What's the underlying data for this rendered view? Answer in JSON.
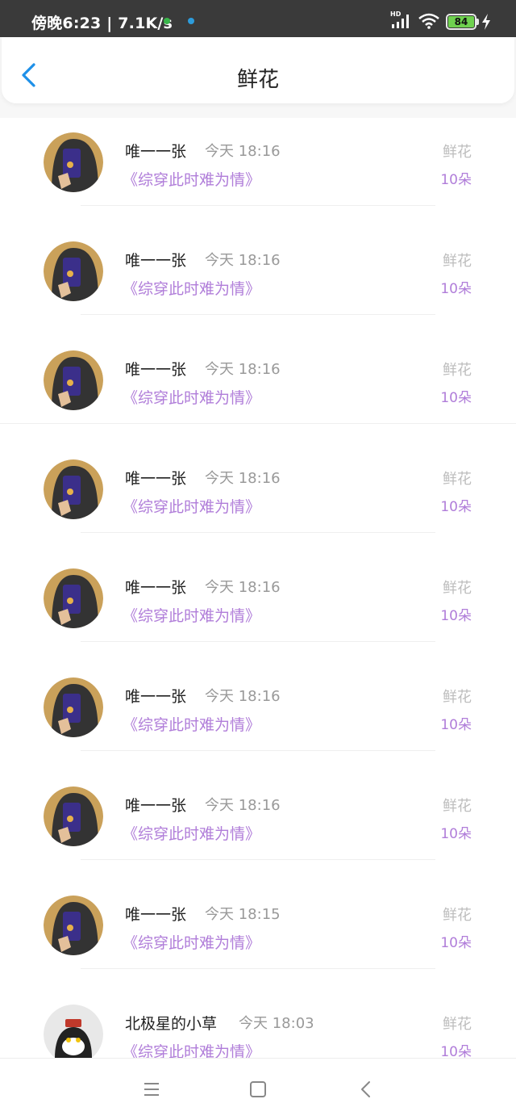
{
  "status_bar": {
    "time_speed": "傍晚6:23 | 7.1K/s",
    "hd_label": "HD",
    "battery": "84",
    "icons": [
      "notification-dot-green",
      "notification-dot-blue",
      "signal-icon",
      "wifi-icon",
      "battery-icon",
      "charging-icon"
    ]
  },
  "header": {
    "back_icon": "chevron-left-icon",
    "title": "鲜花"
  },
  "records": [
    {
      "user": "唯一一张",
      "time": "今天 18:16",
      "book": "《综穿此时难为情》",
      "kind": "鲜花",
      "count": "10朵",
      "avatar": "photo-avatar"
    },
    {
      "user": "唯一一张",
      "time": "今天 18:16",
      "book": "《综穿此时难为情》",
      "kind": "鲜花",
      "count": "10朵",
      "avatar": "photo-avatar"
    },
    {
      "user": "唯一一张",
      "time": "今天 18:16",
      "book": "《综穿此时难为情》",
      "kind": "鲜花",
      "count": "10朵",
      "avatar": "photo-avatar"
    },
    {
      "user": "唯一一张",
      "time": "今天 18:16",
      "book": "《综穿此时难为情》",
      "kind": "鲜花",
      "count": "10朵",
      "avatar": "photo-avatar"
    },
    {
      "user": "唯一一张",
      "time": "今天 18:16",
      "book": "《综穿此时难为情》",
      "kind": "鲜花",
      "count": "10朵",
      "avatar": "photo-avatar"
    },
    {
      "user": "唯一一张",
      "time": "今天 18:16",
      "book": "《综穿此时难为情》",
      "kind": "鲜花",
      "count": "10朵",
      "avatar": "photo-avatar"
    },
    {
      "user": "唯一一张",
      "time": "今天 18:16",
      "book": "《综穿此时难为情》",
      "kind": "鲜花",
      "count": "10朵",
      "avatar": "photo-avatar"
    },
    {
      "user": "唯一一张",
      "time": "今天 18:15",
      "book": "《综穿此时难为情》",
      "kind": "鲜花",
      "count": "10朵",
      "avatar": "photo-avatar"
    },
    {
      "user": "北极星的小草",
      "time": "今天 18:03",
      "book": "《综穿此时难为情》",
      "kind": "鲜花",
      "count": "10朵",
      "avatar": "cat-avatar"
    }
  ],
  "nav_bar": {
    "icons": [
      "menu-icon",
      "home-icon",
      "back-icon"
    ]
  }
}
